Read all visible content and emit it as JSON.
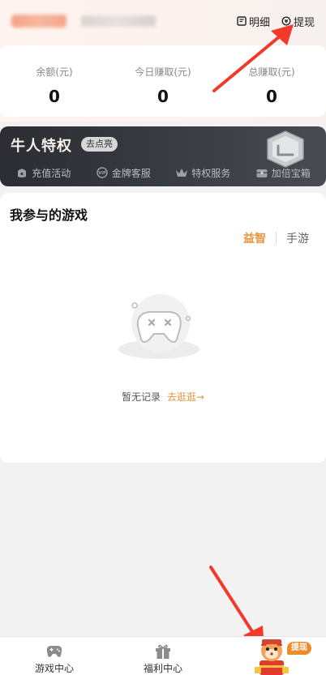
{
  "header": {
    "details_label": "明细",
    "withdraw_label": "提现"
  },
  "stats": [
    {
      "label": "余额(元)",
      "value": "0"
    },
    {
      "label": "今日赚取(元)",
      "value": "0"
    },
    {
      "label": "总赚取(元)",
      "value": "0"
    }
  ],
  "vip": {
    "title": "牛人特权",
    "cta": "去点亮",
    "items": [
      {
        "label": "充值活动",
        "icon": "wallet-icon"
      },
      {
        "label": "金牌客服",
        "icon": "vip-service-icon"
      },
      {
        "label": "特权服务",
        "icon": "crown-icon"
      },
      {
        "label": "加倍宝箱",
        "icon": "chest-icon"
      }
    ]
  },
  "games": {
    "title": "我参与的游戏",
    "tabs": [
      "益智",
      "手游"
    ],
    "active_tab": "益智",
    "empty_text": "暂无记录",
    "empty_link": "去逛逛→"
  },
  "nav": {
    "items": [
      {
        "label": "游戏中心",
        "icon": "gamepad-icon"
      },
      {
        "label": "福利中心",
        "icon": "gift-icon"
      }
    ],
    "withdraw_badge": "提现"
  },
  "colors": {
    "accent": "#e9923a",
    "vip_bg": "#2b2d33",
    "arrow": "#f2392b"
  }
}
